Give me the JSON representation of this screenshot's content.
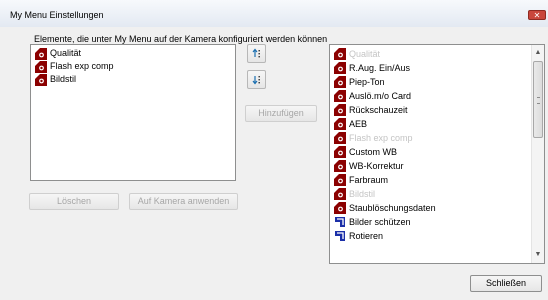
{
  "window": {
    "title": "My Menu Einstellungen",
    "close_glyph": "✕"
  },
  "caption": "Elemente, die unter My Menu auf der Kamera konfiguriert werden können",
  "selected_list": {
    "items": [
      {
        "label": "Qualität",
        "icon": "camera-red-icon"
      },
      {
        "label": "Flash exp comp",
        "icon": "camera-red-icon"
      },
      {
        "label": "Bildstil",
        "icon": "camera-red-icon"
      }
    ]
  },
  "available_list": {
    "items": [
      {
        "label": "Qualität",
        "icon": "camera-red-icon",
        "disabled": true
      },
      {
        "label": "R.Aug. Ein/Aus",
        "icon": "camera-red-icon",
        "disabled": false
      },
      {
        "label": "Piep-Ton",
        "icon": "camera-red-icon",
        "disabled": false
      },
      {
        "label": "Auslö.m/o Card",
        "icon": "camera-red-icon",
        "disabled": false
      },
      {
        "label": "Rückschauzeit",
        "icon": "camera-red-icon",
        "disabled": false
      },
      {
        "label": "AEB",
        "icon": "camera-red-icon",
        "disabled": false
      },
      {
        "label": "Flash exp comp",
        "icon": "camera-red-icon",
        "disabled": true
      },
      {
        "label": "Custom WB",
        "icon": "camera-red-icon",
        "disabled": false
      },
      {
        "label": "WB-Korrektur",
        "icon": "camera-red-icon",
        "disabled": false
      },
      {
        "label": "Farbraum",
        "icon": "camera-red-icon",
        "disabled": false
      },
      {
        "label": "Bildstil",
        "icon": "camera-red-icon",
        "disabled": true
      },
      {
        "label": "Staublöschungsdaten",
        "icon": "camera-red-icon",
        "disabled": false
      },
      {
        "label": "Bilder schützen",
        "icon": "playback-blue-icon",
        "disabled": false
      },
      {
        "label": "Rotieren",
        "icon": "playback-blue-icon",
        "disabled": false
      }
    ]
  },
  "buttons": {
    "add": "Hinzufügen",
    "delete": "Löschen",
    "apply": "Auf Kamera anwenden",
    "close": "Schließen"
  },
  "colors": {
    "camera_icon": "#8b0000",
    "playback_icon": "#1b2fa8",
    "disabled_text": "#c4c4c4"
  }
}
